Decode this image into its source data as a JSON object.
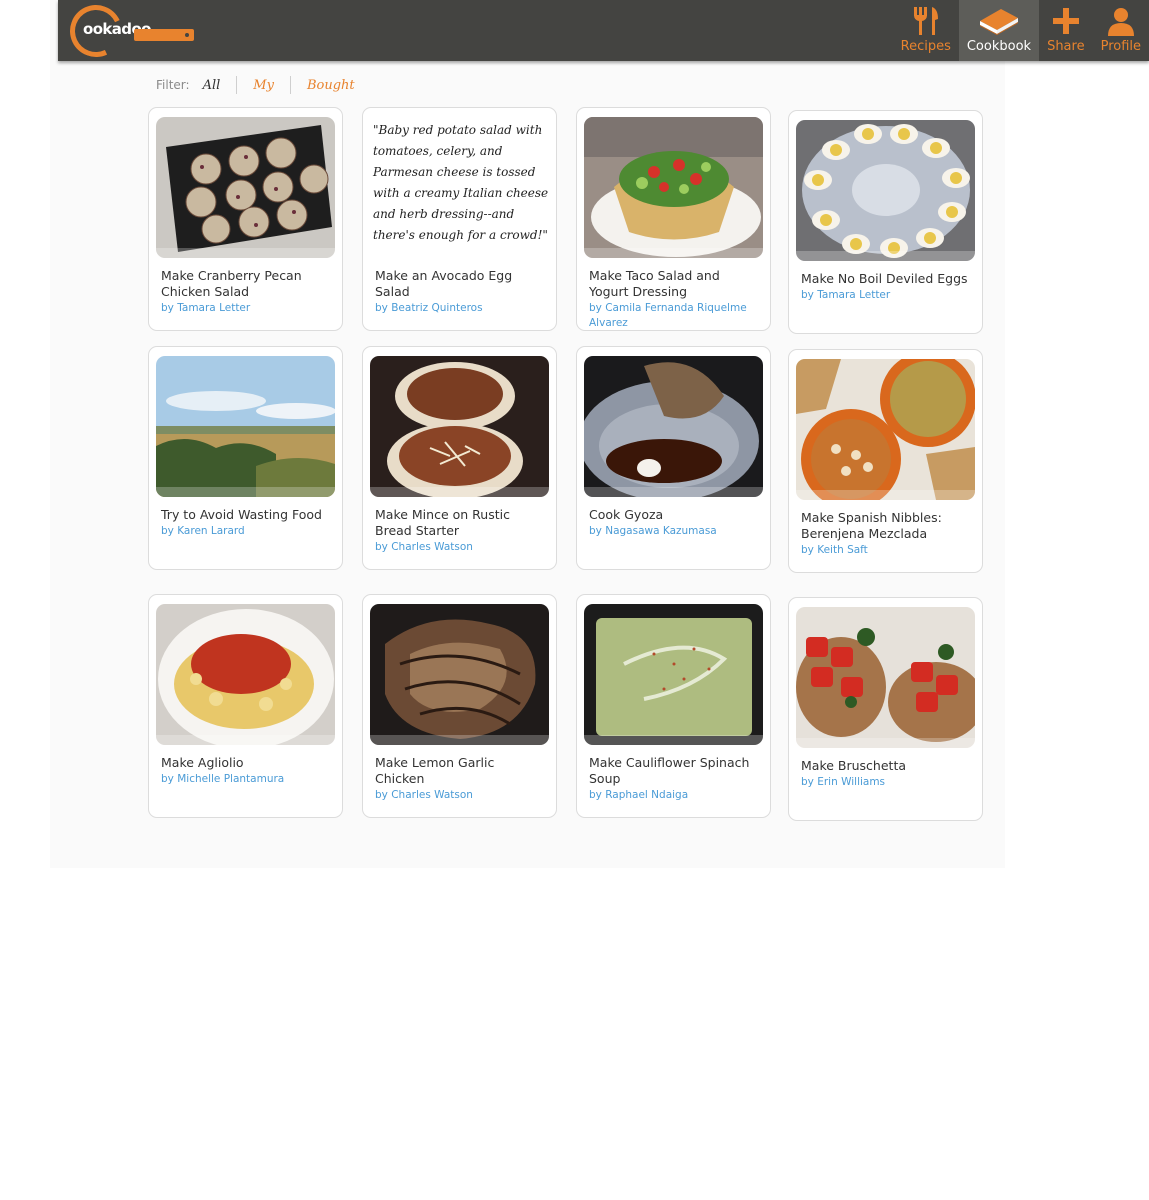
{
  "brand": {
    "logo_text": "ookadoo"
  },
  "nav": [
    {
      "label": "Recipes",
      "icon": "fork-knife-icon",
      "active": false
    },
    {
      "label": "Cookbook",
      "icon": "book-icon",
      "active": true
    },
    {
      "label": "Share",
      "icon": "plus-icon",
      "active": false
    },
    {
      "label": "Profile",
      "icon": "user-icon",
      "active": false
    }
  ],
  "filter": {
    "label": "Filter:",
    "options": [
      "All",
      "My",
      "Bought"
    ],
    "selected": "All"
  },
  "recipes": [
    {
      "title": "Make Cranberry Pecan Chicken Salad",
      "author": "by Tamara Letter",
      "image": "cranberry-pecan-chicken-salad-photo"
    },
    {
      "title": "Make an Avocado Egg Salad",
      "author": "by Beatriz Quinteros",
      "quote": "\"Baby red potato salad with tomatoes, celery, and Parmesan cheese is tossed with a creamy Italian cheese and herb dressing--and there's enough for a crowd!\""
    },
    {
      "title": "Make Taco Salad and Yogurt Dressing",
      "author": "by Camila Fernanda Riquelme Alvarez",
      "image": "taco-salad-photo"
    },
    {
      "title": "Make No Boil Deviled Eggs",
      "author": "by Tamara Letter",
      "image": "deviled-eggs-photo"
    },
    {
      "title": "Try to Avoid Wasting Food",
      "author": "by Karen Larard",
      "image": "field-landscape-photo"
    },
    {
      "title": "Make Mince on Rustic Bread Starter",
      "author": "by Charles Watson",
      "image": "mince-on-bread-photo"
    },
    {
      "title": "Cook Gyoza",
      "author": "by Nagasawa Kazumasa",
      "image": "gyoza-photo"
    },
    {
      "title": "Make Spanish Nibbles: Berenjena Mezclada",
      "author": "by Keith Saft",
      "image": "spanish-nibbles-photo"
    },
    {
      "title": "Make Agliolio",
      "author": "by Michelle Plantamura",
      "image": "pasta-agliolio-photo"
    },
    {
      "title": "Make Lemon Garlic Chicken",
      "author": "by Charles Watson",
      "image": "lemon-garlic-chicken-photo"
    },
    {
      "title": "Make Cauliflower Spinach Soup",
      "author": "by Raphael Ndaiga",
      "image": "cauliflower-soup-photo"
    },
    {
      "title": "Make Bruschetta",
      "author": "by Erin Williams",
      "image": "bruschetta-photo"
    }
  ],
  "colors": {
    "accent": "#e8832e",
    "topbar": "#444441",
    "link": "#4a9bd6"
  }
}
